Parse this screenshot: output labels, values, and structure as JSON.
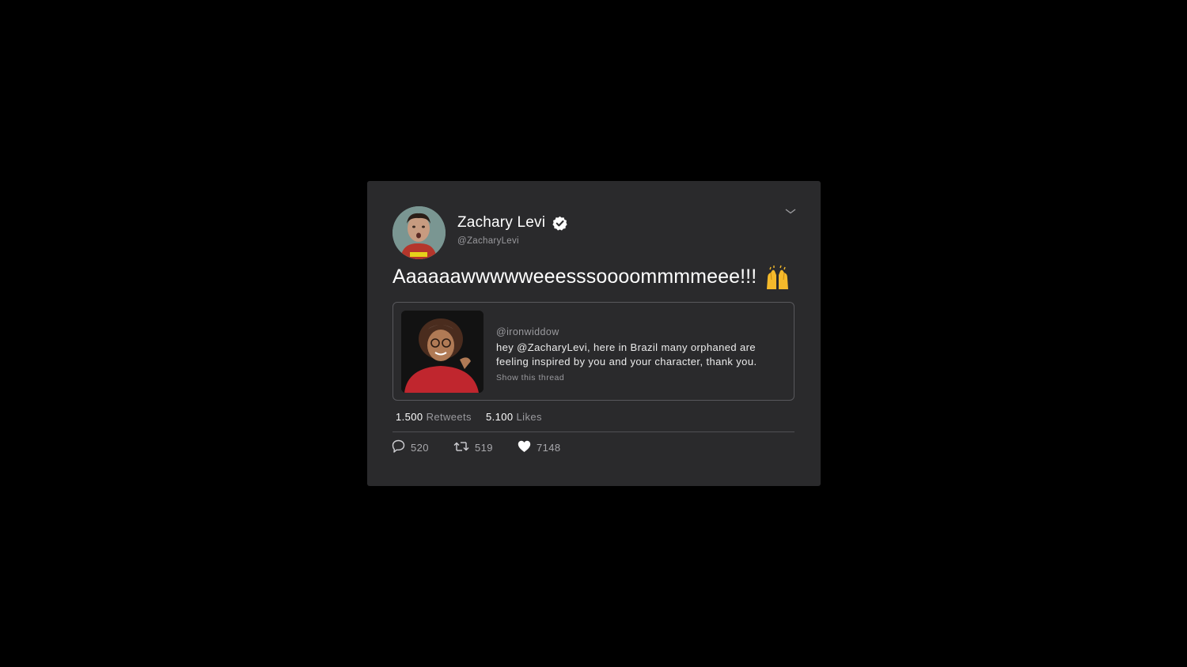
{
  "tweet": {
    "author_name": "Zachary Levi",
    "author_handle": "@ZacharyLevi",
    "text": "Aaaaaawwwwweeesssoooommmmeee!!!",
    "emoji": "raising-hands-emoji"
  },
  "quote": {
    "handle": "@ironwiddow",
    "text": "hey @ZacharyLevi, here in Brazil many orphaned are feeling inspired by you and your character, thank you.",
    "thread_link": "Show this thread"
  },
  "stats": {
    "retweets_count": "1.500",
    "retweets_label": "Retweets",
    "likes_count": "5.100",
    "likes_label": "Likes"
  },
  "actions": {
    "replies": "520",
    "retweets": "519",
    "likes": "7148"
  },
  "icons": [
    "verified-badge-icon",
    "chevron-down-icon",
    "reply-icon",
    "retweet-icon",
    "heart-icon"
  ],
  "colors": {
    "background": "#000000",
    "card": "#2a2a2c",
    "muted_text": "#9a9a9e",
    "emoji_yellow": "#f4b92b"
  }
}
